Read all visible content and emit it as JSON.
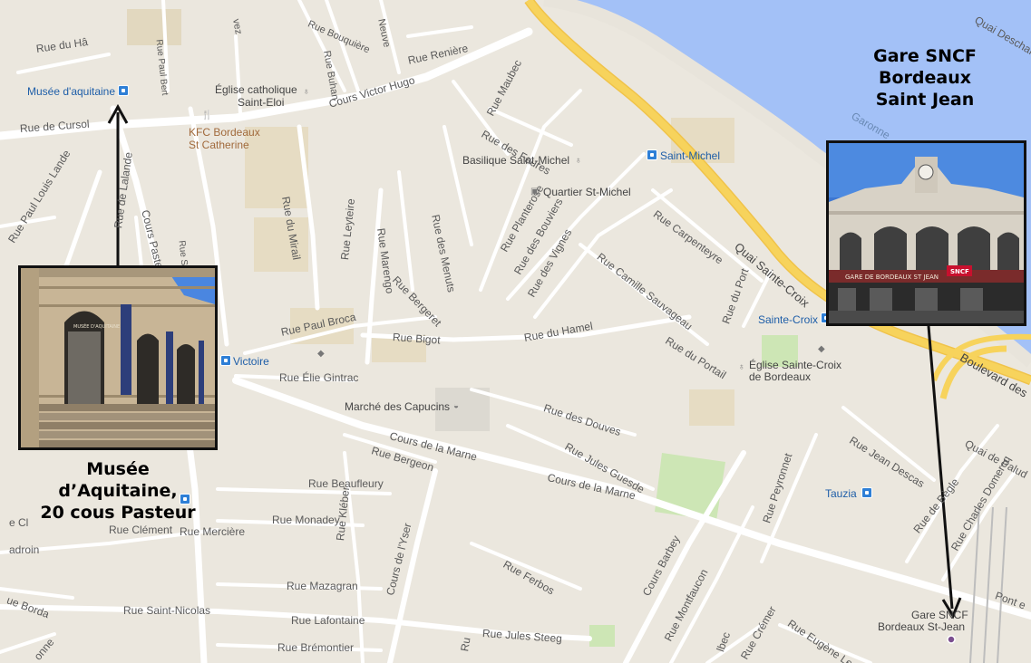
{
  "streets": {
    "rue_du_ha": "Rue du Hâ",
    "rue_paul_bert": "Rue Paul Bert",
    "rue_buhan": "Rue Buhan",
    "rue_bouquiere": "Rue Bouquière",
    "rue_neuve": "Neuve",
    "rue_reniere": "Rue Renière",
    "rue_du_vez": "vez",
    "cours_victor_hugo": "Cours Victor Hugo",
    "rue_de_cursol": "Rue de Cursol",
    "rue_maubec": "Rue Maubec",
    "rue_des_faures": "Rue des Faures",
    "rue_paul_louis_lande": "Rue Paul Louis Lande",
    "rue_de_lalande": "Rue de Lalande",
    "cours_pasteur": "Cours Pasteur",
    "rue_sainte_catherine": "Rue Sainte-Catherine",
    "rue_du_mirail": "Rue du Mirail",
    "rue_marengo": "Rue Marengo",
    "rue_des_menuts": "Rue des Menuts",
    "rue_leyteire": "Rue Leyteire",
    "rue_planterose": "Rue Planterose",
    "rue_des_bouviers": "Rue des Bouviers",
    "rue_des_vignes": "Rue des Vignes",
    "rue_camille_sauvageau": "Rue Camille Sauvageau",
    "rue_carpenteyre": "Rue Carpenteyre",
    "quai_sainte_croix": "Quai Sainte-Croix",
    "rue_bergeret": "Rue Bergeret",
    "rue_paul_broca": "Rue Paul Broca",
    "rue_bigot": "Rue Bigot",
    "rue_du_hamel": "Rue du Hamel",
    "rue_du_portail": "Rue du Portail",
    "rue_du_port": "Rue du Port",
    "rue_elie_gintrac": "Rue Élie Gintrac",
    "rue_des_douves": "Rue des Douves",
    "cours_de_la_marne_1": "Cours de la Marne",
    "cours_de_la_marne_2": "Cours de la Marne",
    "rue_bergeon": "Rue Bergeon",
    "rue_jules_guesde": "Rue Jules Guesde",
    "rue_beaufleury": "Rue Beaufleury",
    "rue_kleber": "Rue Kléber",
    "rue_monadey": "Rue Monadey",
    "rue_clement": "Rue Clément",
    "rue_merciere": "Rue Mercière",
    "rue_de_l_yser": "Cours de l'Yser",
    "rue_ferbos": "Rue Ferbos",
    "rue_peyronnet": "Rue Peyronnet",
    "rue_jean_descas": "Rue Jean Descas",
    "rue_de_begle": "Rue de Bègle",
    "rue_charles_domercq": "Rue Charles Domercq",
    "quai_de_paludate": "Quai de Palud",
    "boulevard_des": "Boulevard des",
    "rue_mazagran": "Rue Mazagran",
    "cours_barbey": "Cours Barbey",
    "rue_montfaucon": "Rue Montfaucon",
    "rue_saint_nicolas": "Rue Saint-Nicolas",
    "rue_lafontaine": "Rue Lafontaine",
    "rue_jules_steeg": "Rue Jules Steeg",
    "rue_bremontier": "Rue Brémontier",
    "rue_borda": "ue Borda",
    "adroin": "adroin",
    "rue_cl_left": "e Cl",
    "rue_eugene": "Rue Eugène Le R",
    "rue_cremer": "Rue Crémer",
    "rue_lbec": "lbec",
    "onne_bottom": "onne",
    "pont_e": "Pont e",
    "rue_deschan": "Quai Deschan",
    "garonne": "Garonne",
    "rue_u": "Ru"
  },
  "pois": {
    "musee_aquitaine": "Musée d'aquitaine",
    "eglise_saint_eloi_1": "Église catholique",
    "eglise_saint_eloi_2": "Saint-Eloi",
    "kfc_1": "KFC Bordeaux",
    "kfc_2": "St Catherine",
    "basilique": "Basilique Saint-Michel",
    "quartier": "Quartier St-Michel",
    "eglise_sainte_croix_1": "Église Sainte-Croix",
    "eglise_sainte_croix_2": "de Bordeaux",
    "marche": "Marché des Capucins",
    "gare_1": "Gare SNCF",
    "gare_2": "Bordeaux St-Jean"
  },
  "transit": {
    "saint_michel": "Saint-Michel",
    "sainte_croix": "Sainte-Croix",
    "victoire": "Victoire",
    "tauzia": "Tauzia"
  },
  "captions": {
    "gare_line1": "Gare SNCF",
    "gare_line2": "Bordeaux",
    "gare_line3": "Saint Jean",
    "musee_line1": "Musée",
    "musee_line2": "d’Aquitaine,",
    "musee_line3": "20 cous Pasteur"
  },
  "photos": {
    "gare_sign": "GARE DE BORDEAUX ST JEAN",
    "gare_logo": "SNCF",
    "musee_plaque": "MUSÉE D'AQUITAINE"
  },
  "colors": {
    "land": "#ebe7de",
    "water": "#a3c1f7",
    "major_road": "#f7d35c",
    "street": "#ffffff",
    "park": "#cde6b5",
    "arrow": "#111111"
  }
}
